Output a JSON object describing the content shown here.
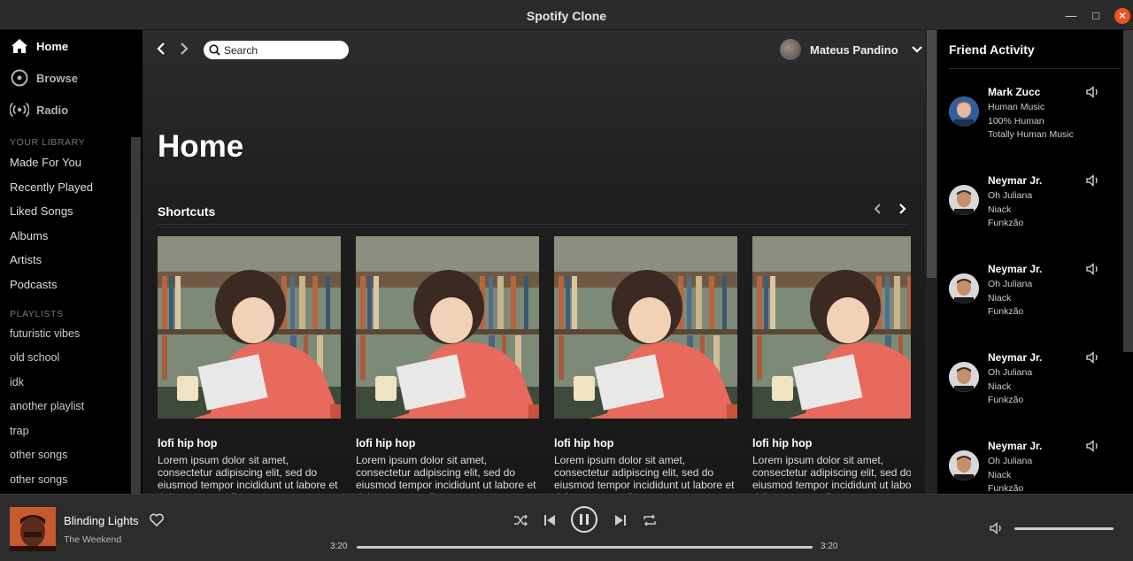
{
  "window": {
    "title": "Spotify Clone"
  },
  "sidebar": {
    "nav": [
      {
        "label": "Home",
        "icon": "home-icon",
        "active": true
      },
      {
        "label": "Browse",
        "icon": "browse-icon",
        "active": false
      },
      {
        "label": "Radio",
        "icon": "radio-icon",
        "active": false
      }
    ],
    "library_label": "YOUR LIBRARY",
    "library": [
      "Made For You",
      "Recently Played",
      "Liked Songs",
      "Albums",
      "Artists",
      "Podcasts"
    ],
    "playlists_label": "PLAYLISTS",
    "playlists": [
      "futuristic vibes",
      "old school",
      "idk",
      "another playlist",
      "trap",
      "other songs",
      "other songs"
    ]
  },
  "header": {
    "search_placeholder": "Search",
    "user_name": "Mateus Pandino"
  },
  "main": {
    "page_title": "Home",
    "section_title": "Shortcuts",
    "cards": [
      {
        "title": "lofi hip hop",
        "description": "Lorem ipsum dolor sit amet, consectetur adipiscing elit, sed do eiusmod tempor incididunt ut labore et dolore magna aliqua."
      },
      {
        "title": "lofi hip hop",
        "description": "Lorem ipsum dolor sit amet, consectetur adipiscing elit, sed do eiusmod tempor incididunt ut labore et dolore magna aliqua."
      },
      {
        "title": "lofi hip hop",
        "description": "Lorem ipsum dolor sit amet, consectetur adipiscing elit, sed do eiusmod tempor incididunt ut labore et dolore magna aliqua."
      },
      {
        "title": "lofi hip hop",
        "description": "Lorem ipsum dolor sit amet, consectetur adipiscing elit, sed do eiusmod tempor incididunt ut labore et dolore magna aliqua."
      }
    ]
  },
  "friends": {
    "title": "Friend Activity",
    "list": [
      {
        "name": "Mark Zucc",
        "song": "Human Music",
        "artist": "100% Human",
        "album": "Totally Human Music"
      },
      {
        "name": "Neymar Jr.",
        "song": "Oh Juliana",
        "artist": "Niack",
        "album": "Funkzão"
      },
      {
        "name": "Neymar Jr.",
        "song": "Oh Juliana",
        "artist": "Niack",
        "album": "Funkzão"
      },
      {
        "name": "Neymar Jr.",
        "song": "Oh Juliana",
        "artist": "Niack",
        "album": "Funkzão"
      },
      {
        "name": "Neymar Jr.",
        "song": "Oh Juliana",
        "artist": "Niack",
        "album": "Funkzão"
      }
    ]
  },
  "player": {
    "track": "Blinding Lights",
    "artist": "The Weekend",
    "elapsed": "3:20",
    "duration": "3:20",
    "progress": 1.0,
    "volume": 1.0
  },
  "colors": {
    "accent": "#e95420",
    "background": "#121212",
    "sidebar": "#000000"
  }
}
